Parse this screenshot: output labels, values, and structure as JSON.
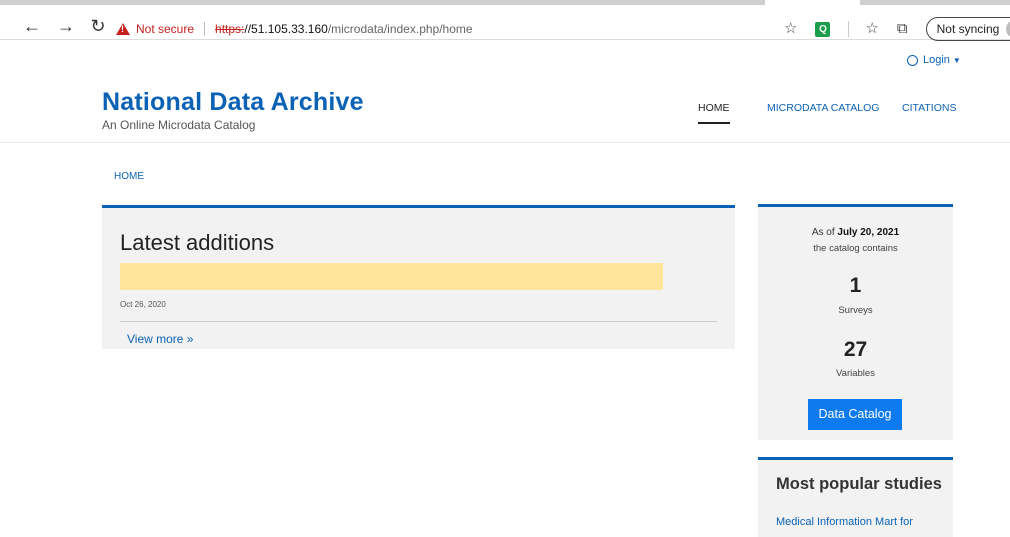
{
  "browser": {
    "back_icon": "←",
    "forward_icon": "→",
    "reload_icon": "↻",
    "security_label": "Not secure",
    "url_proto": "https:",
    "url_host": "//51.105.33.160",
    "url_path": "/microdata/index.php/home",
    "ext_label": "Q",
    "sync_label": "Not syncing"
  },
  "header": {
    "login": "Login",
    "title": "National Data Archive",
    "subtitle": "An Online Microdata Catalog",
    "nav": [
      "HOME",
      "MICRODATA CATALOG",
      "CITATIONS"
    ]
  },
  "breadcrumb": "HOME",
  "latest": {
    "title": "Latest additions",
    "date": "Oct 26, 2020",
    "view_more": "View more »"
  },
  "stats": {
    "as_of_prefix": "As of ",
    "as_of_date": "July 20, 2021",
    "contains": "the catalog contains",
    "surveys_count": "1",
    "surveys_label": "Surveys",
    "variables_count": "27",
    "variables_label": "Variables",
    "button": "Data Catalog"
  },
  "popular": {
    "title": "Most popular studies",
    "first_item": "Medical Information Mart for"
  },
  "colors": {
    "brand": "#0b62b5",
    "button": "#0d7af0",
    "highlight": "#ffe49a",
    "panel": "#f2f2f2"
  }
}
